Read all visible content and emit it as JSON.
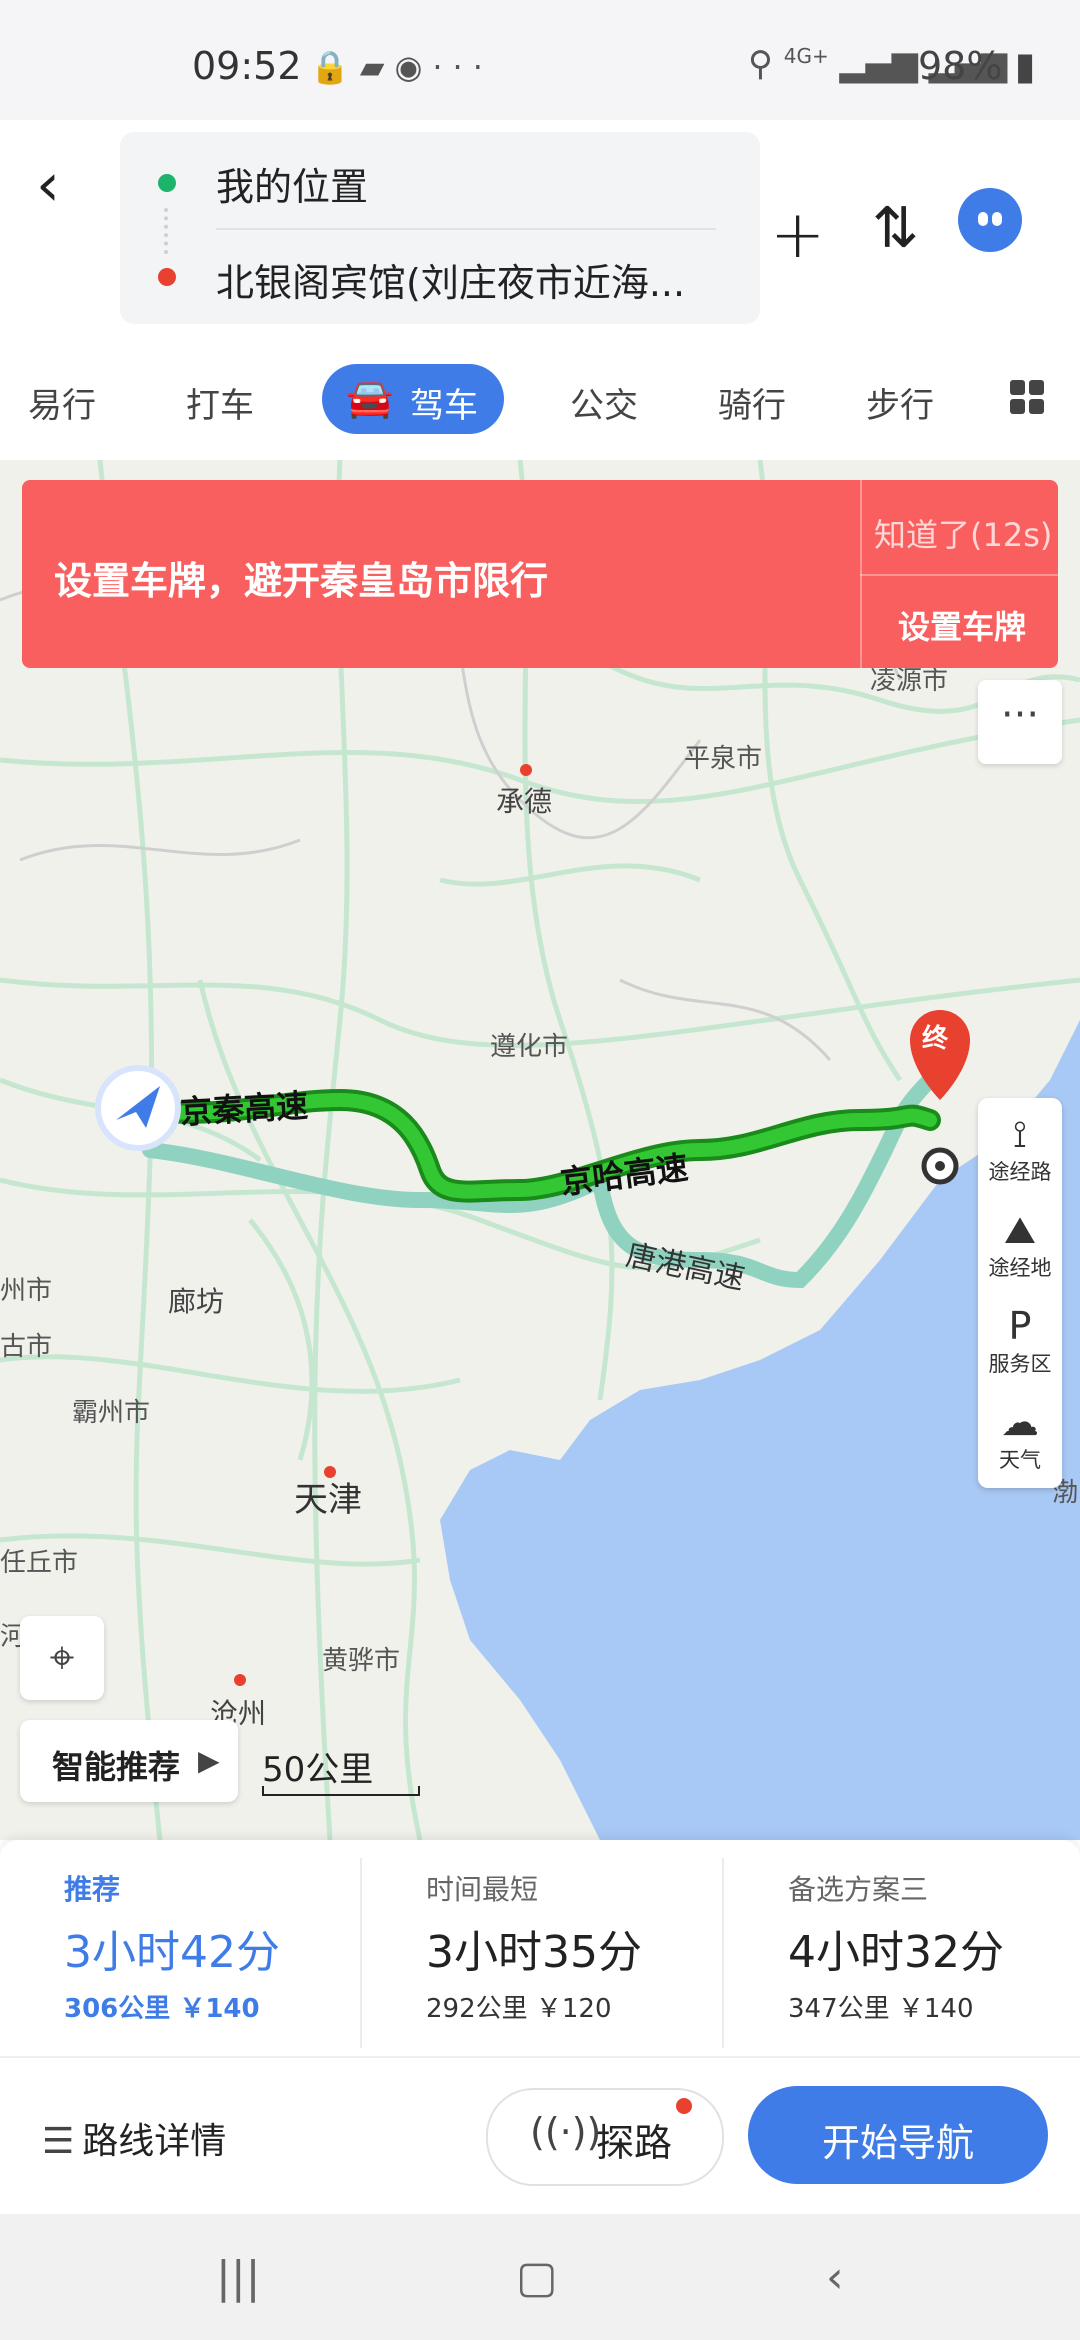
{
  "status_bar": {
    "time": "09:52",
    "left_icons": [
      "lock-icon",
      "message-icon",
      "sync-icon",
      "more-dots-icon"
    ],
    "network": "4G+",
    "battery": "98%"
  },
  "header": {
    "start": "我的位置",
    "destination": "北银阁宾馆(刘庄夜市近海..."
  },
  "modes": {
    "tabs": [
      "易行",
      "打车",
      "驾车",
      "公交",
      "骑行",
      "步行"
    ],
    "active": "驾车"
  },
  "banner": {
    "message": "设置车牌，避开秦皇岛市限行",
    "dismiss": "知道了(12s)",
    "action": "设置车牌"
  },
  "map": {
    "cities": [
      "凌源市",
      "平泉市",
      "承德",
      "遵化市",
      "廊坊",
      "霸州市",
      "天津",
      "黄骅市",
      "沧州",
      "任丘市",
      "渤"
    ],
    "partial_labels": [
      "州市",
      "古市",
      "河"
    ],
    "roads": [
      "京秦高速",
      "京哈高速",
      "唐港高速"
    ],
    "end_marker": "终",
    "colors": {
      "route_main": "#2db82d",
      "route_alt": "#8fd2bf",
      "sea": "#a8c8f5",
      "land": "#f1f1ec",
      "roads": "#c6e7cf"
    }
  },
  "side_tools": [
    {
      "icon": "waypoint-route-icon",
      "label": "途经路"
    },
    {
      "icon": "waypoint-place-icon",
      "label": "途经地"
    },
    {
      "icon": "service-area-icon",
      "label": "服务区"
    },
    {
      "icon": "weather-cloud-icon",
      "label": "天气"
    }
  ],
  "controls": {
    "smart": "智能推荐",
    "scale": "50公里"
  },
  "routes": [
    {
      "name": "推荐",
      "duration": "3小时42分",
      "info": "306公里 ￥140",
      "selected": true
    },
    {
      "name": "时间最短",
      "duration": "3小时35分",
      "info": "292公里 ￥120",
      "selected": false
    },
    {
      "name": "备选方案三",
      "duration": "4小时32分",
      "info": "347公里 ￥140",
      "selected": false
    }
  ],
  "actions": {
    "details": "路线详情",
    "explore": "探路",
    "start": "开始导航"
  },
  "accent": "#3f7ce8",
  "alert_color": "#fa5f5f"
}
